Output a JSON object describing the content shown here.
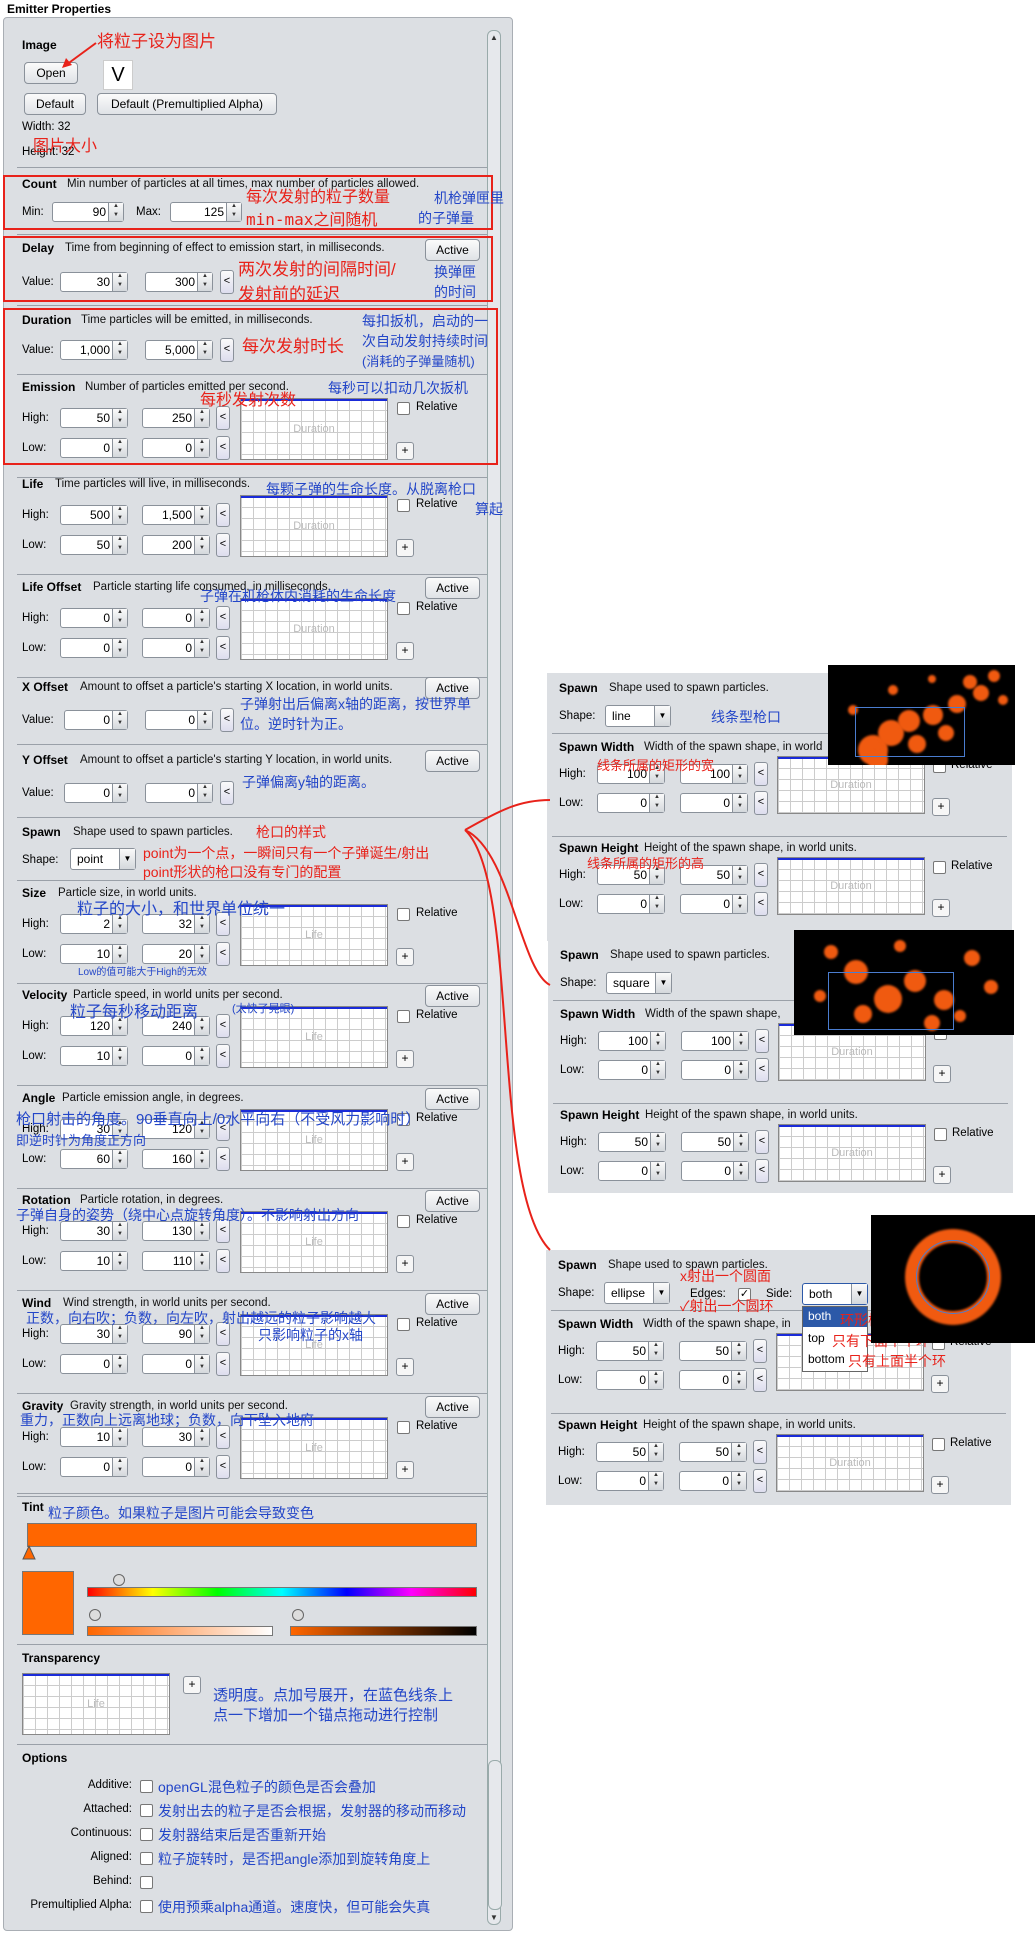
{
  "window": {
    "title": "Emitter Properties"
  },
  "image": {
    "heading": "Image",
    "open": "Open",
    "preview": "V",
    "default": "Default",
    "default_pma": "Default (Premultiplied Alpha)",
    "width": "Width: 32",
    "height": "Height: 32",
    "ann_set": "将粒子设为图片",
    "ann_size": "图片大小"
  },
  "count": {
    "heading": "Count",
    "desc": "Min number of particles at all times, max number of particles allowed.",
    "min_label": "Min:",
    "min": "90",
    "max_label": "Max:",
    "max": "125",
    "ann1": "每次发射的粒子数量",
    "ann2": "min-max之间随机",
    "ann3": "机枪弹匣里",
    "ann4": "的子弹量"
  },
  "delay": {
    "heading": "Delay",
    "desc": "Time from beginning of effect to emission start, in milliseconds.",
    "active": "Active",
    "value_label": "Value:",
    "v1": "30",
    "v2": "300",
    "ann1": "两次发射的间隔时间/",
    "ann2": "发射前的延迟",
    "ann3": "换弹匣",
    "ann4": "的时间"
  },
  "duration": {
    "heading": "Duration",
    "desc": "Time particles will be emitted, in milliseconds.",
    "value_label": "Value:",
    "v1": "1,000",
    "v2": "5,000",
    "ann1": "每次发射时长",
    "ann2": "每扣扳机，启动的一",
    "ann3": "次自动发射持续时间",
    "ann4": "(消耗的子弹量随机)"
  },
  "emission": {
    "heading": "Emission",
    "desc": "Number of particles emitted per second.",
    "high_label": "High:",
    "low_label": "Low:",
    "high1": "50",
    "high2": "250",
    "low1": "0",
    "low2": "0",
    "graph": "Duration",
    "relative": "Relative",
    "ann1": "每秒发射次数",
    "ann2": "每秒可以扣动几次扳机"
  },
  "life": {
    "heading": "Life",
    "desc": "Time particles will live, in milliseconds.",
    "high1": "500",
    "high2": "1,500",
    "low1": "50",
    "low2": "200",
    "graph": "Duration",
    "ann1": "每颗子弹的生命长度。从脱离枪口",
    "ann2": "算起"
  },
  "life_offset": {
    "heading": "Life Offset",
    "desc": "Particle starting life consumed, in milliseconds.",
    "high1": "0",
    "high2": "0",
    "low1": "0",
    "low2": "0",
    "graph": "Duration",
    "ann1": "子弹在机枪体内消耗的生命长度"
  },
  "x_offset": {
    "heading": "X Offset",
    "desc": "Amount to offset a particle's starting X location, in world units.",
    "v1": "0",
    "v2": "0",
    "ann1": "子弹射出后偏离x轴的距离，按世界单",
    "ann2": "位。逆时针为正。"
  },
  "y_offset": {
    "heading": "Y Offset",
    "desc": "Amount to offset a particle's starting Y location, in world units.",
    "v1": "0",
    "v2": "0",
    "ann1": "子弹偏离y轴的距离。"
  },
  "spawn": {
    "heading": "Spawn",
    "desc": "Shape used to spawn particles.",
    "shape_label": "Shape:",
    "shape": "point",
    "ann1": "枪口的样式",
    "ann2": "point为一个点，一瞬间只有一个子弹诞生/射出",
    "ann3": "point形状的枪口没有专门的配置"
  },
  "size": {
    "heading": "Size",
    "desc": "Particle size, in world units.",
    "high1": "2",
    "high2": "32",
    "low1": "10",
    "low2": "20",
    "graph": "Life",
    "ann1": "粒子的大小，和世界单位统一",
    "ann2": "Low的值可能大于High的无效"
  },
  "velocity": {
    "heading": "Velocity",
    "desc": "Particle speed, in world units per second.",
    "high1": "120",
    "high2": "240",
    "low1": "10",
    "low2": "0",
    "graph": "Life",
    "ann1": "粒子每秒移动距离",
    "ann2": "(太快了晃眼)"
  },
  "angle": {
    "heading": "Angle",
    "desc": "Particle emission angle, in degrees.",
    "high1": "30",
    "high2": "120",
    "low1": "60",
    "low2": "160",
    "graph": "Life",
    "ann1": "枪口射击的角度。90垂直向上/0水平向右（不受风力影响时）",
    "ann2": "即逆时针为角度正方向"
  },
  "rotation": {
    "heading": "Rotation",
    "desc": "Particle rotation, in degrees.",
    "high1": "30",
    "high2": "130",
    "low1": "10",
    "low2": "110",
    "graph": "Life",
    "ann1": "子弹自身的姿势（绕中心点旋转角度）。不影响射出方向"
  },
  "wind": {
    "heading": "Wind",
    "desc": "Wind strength, in world units per second.",
    "high1": "30",
    "high2": "90",
    "low1": "0",
    "low2": "0",
    "graph": "Life",
    "ann1": "正数，向右吹；负数，向左吹，射出越远的粒子影响越大",
    "ann2": "只影响粒子的x轴"
  },
  "gravity": {
    "heading": "Gravity",
    "desc": "Gravity strength, in world units per second.",
    "high1": "10",
    "high2": "30",
    "low1": "0",
    "low2": "0",
    "graph": "Life",
    "ann1": "重力，正数向上远离地球；负数，向下坠入地府"
  },
  "tint": {
    "heading": "Tint",
    "color": "#ff6600",
    "ann1": "粒子颜色。如果粒子是图片可能会导致变色"
  },
  "transparency": {
    "heading": "Transparency",
    "graph": "Life",
    "ann1": "透明度。点加号展开，在蓝色线条上",
    "ann2": "点一下增加一个锚点拖动进行控制"
  },
  "options": {
    "heading": "Options",
    "items": [
      {
        "label": "Additive:",
        "ann": "openGL混色粒子的颜色是否会叠加"
      },
      {
        "label": "Attached:",
        "ann": "发射出去的粒子是否会根据，发射器的移动而移动"
      },
      {
        "label": "Continuous:",
        "ann": "发射器结束后是否重新开始"
      },
      {
        "label": "Aligned:",
        "ann": "粒子旋转时，是否把angle添加到旋转角度上"
      },
      {
        "label": "Behind:",
        "ann": ""
      },
      {
        "label": "Premultiplied Alpha:",
        "ann": "使用预乘alpha通道。速度快，但可能会失真"
      }
    ]
  },
  "right": {
    "line": {
      "heading": "Spawn",
      "desc": "Shape used to spawn particles.",
      "shape": "line",
      "ann": "线条型枪口",
      "w_heading": "Spawn Width",
      "w_desc": "Width of the spawn shape, in world",
      "w_ann": "线条所属的矩形的宽",
      "w_high1": "100",
      "w_high2": "100",
      "w_low1": "0",
      "w_low2": "0",
      "h_heading": "Spawn Height",
      "h_desc": "Height of the spawn shape, in world units.",
      "h_ann": "线条所属的矩形的高",
      "h_high1": "50",
      "h_high2": "50",
      "h_low1": "0",
      "h_low2": "0"
    },
    "square": {
      "heading": "Spawn",
      "desc": "Shape used to spawn particles.",
      "shape": "square",
      "w_heading": "Spawn Width",
      "w_desc": "Width of the spawn shape,",
      "w_high1": "100",
      "w_high2": "100",
      "w_low1": "0",
      "w_low2": "0",
      "h_heading": "Spawn Height",
      "h_desc": "Height of the spawn shape, in world units.",
      "h_high1": "50",
      "h_high2": "50",
      "h_low1": "0",
      "h_low2": "0"
    },
    "ellipse": {
      "heading": "Spawn",
      "desc": "Shape used to spawn particles.",
      "shape": "ellipse",
      "edges_label": "Edges:",
      "side_label": "Side:",
      "side": "both",
      "side_options": [
        "both",
        "top",
        "bottom"
      ],
      "ann_edge1": "x射出一个圆面",
      "ann_edge2": "✓射出一个圆环",
      "ann_ring": "环形枪口",
      "ann_top": "只有下面半个环",
      "ann_bottom": "只有上面半个环",
      "w_heading": "Spawn Width",
      "w_desc": "Width of the spawn shape, in",
      "w_high1": "50",
      "w_high2": "50",
      "w_low1": "0",
      "w_low2": "0",
      "h_heading": "Spawn Height",
      "h_desc": "Height of the spawn shape, in world units.",
      "h_high1": "50",
      "h_high2": "50",
      "h_low1": "0",
      "h_low2": "0"
    }
  },
  "labels": {
    "high": "High:",
    "low": "Low:",
    "value": "Value:",
    "relative": "Relative",
    "active": "Active",
    "shape": "Shape:",
    "lt": "<",
    "plus": "+"
  }
}
